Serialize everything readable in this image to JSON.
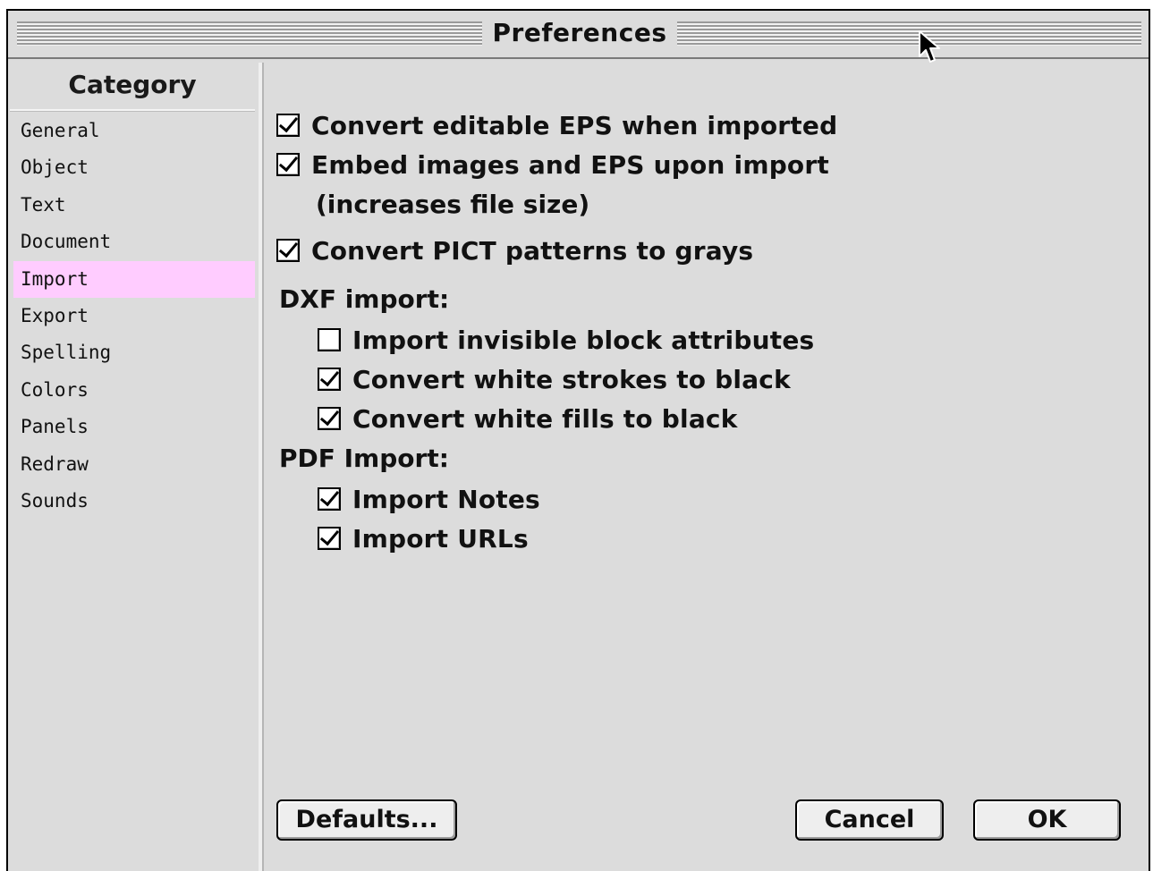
{
  "window": {
    "title": "Preferences"
  },
  "sidebar": {
    "header": "Category",
    "selected": "Import",
    "items": [
      {
        "label": "General"
      },
      {
        "label": "Object"
      },
      {
        "label": "Text"
      },
      {
        "label": "Document"
      },
      {
        "label": "Import"
      },
      {
        "label": "Export"
      },
      {
        "label": "Spelling"
      },
      {
        "label": "Colors"
      },
      {
        "label": "Panels"
      },
      {
        "label": "Redraw"
      },
      {
        "label": "Sounds"
      }
    ]
  },
  "import": {
    "convert_eps": {
      "label": "Convert editable EPS when imported",
      "checked": true
    },
    "embed_images": {
      "label": "Embed images and EPS upon import",
      "note": "(increases file size)",
      "checked": true
    },
    "convert_pict": {
      "label": "Convert PICT patterns to grays",
      "checked": true
    },
    "dxf": {
      "heading": "DXF import:",
      "invisible_blocks": {
        "label": "Import invisible block attributes",
        "checked": false
      },
      "white_strokes": {
        "label": "Convert white strokes to black",
        "checked": true
      },
      "white_fills": {
        "label": "Convert white fills to black",
        "checked": true
      }
    },
    "pdf": {
      "heading": "PDF Import:",
      "notes": {
        "label": "Import Notes",
        "checked": true
      },
      "urls": {
        "label": "Import URLs",
        "checked": true
      }
    }
  },
  "buttons": {
    "defaults": "Defaults...",
    "cancel": "Cancel",
    "ok": "OK"
  },
  "colors": {
    "selection_highlight": "#ffccff",
    "window_background": "#dcdcdc"
  },
  "icons": {
    "cursor": "arrow-cursor-icon"
  }
}
